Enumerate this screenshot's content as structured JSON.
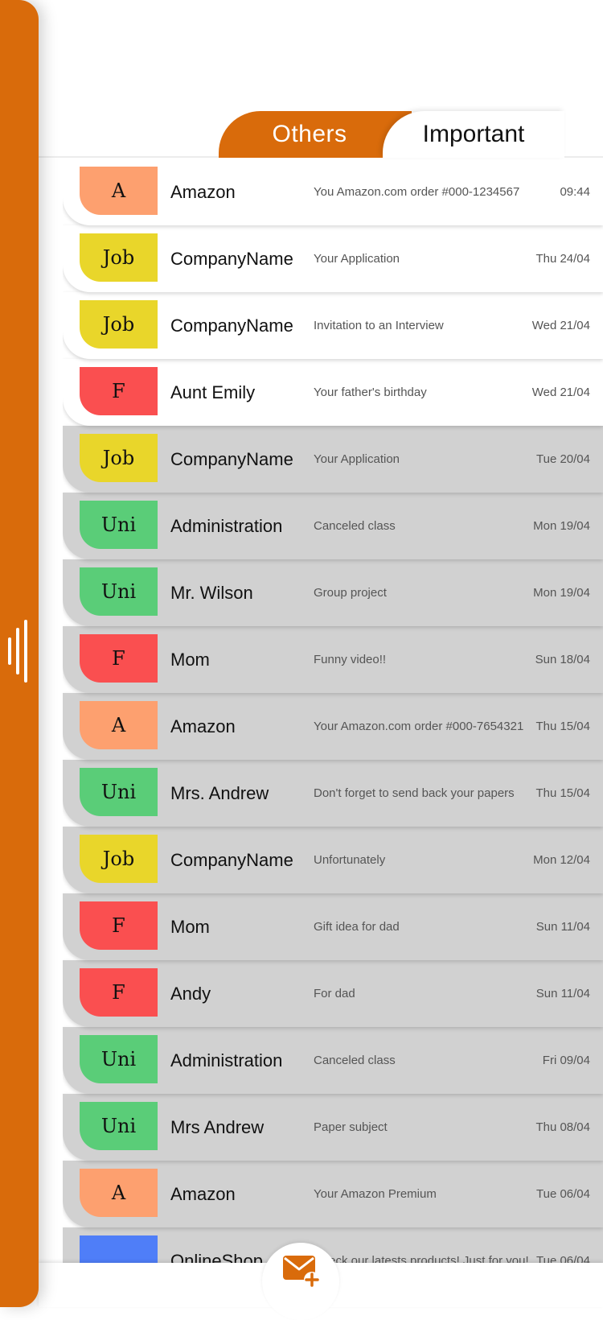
{
  "colors": {
    "accent": "#d96b0b",
    "read_row": "#d1d1d1",
    "unread_row": "#ffffff",
    "categories": {
      "A": "#fda06f",
      "Job": "#e9d62a",
      "F": "#fa4f50",
      "Uni": "#5acd78",
      "OnlineShop": "#4f7ef8"
    }
  },
  "tabs": {
    "others": "Others",
    "important": "Important"
  },
  "sidebar": {
    "handle_icon": "handle-bars-icon"
  },
  "compose": {
    "icon": "mail-plus-icon"
  },
  "emails": [
    {
      "badge": "A",
      "category": "A",
      "sender": "Amazon",
      "subject": "You Amazon.com order #000-1234567",
      "date": "09:44",
      "read": false
    },
    {
      "badge": "Job",
      "category": "Job",
      "sender": "CompanyName",
      "subject": "Your Application",
      "date": "Thu 24/04",
      "read": false
    },
    {
      "badge": "Job",
      "category": "Job",
      "sender": "CompanyName",
      "subject": "Invitation to an Interview",
      "date": "Wed 21/04",
      "read": false
    },
    {
      "badge": "F",
      "category": "F",
      "sender": "Aunt Emily",
      "subject": "Your father's birthday",
      "date": "Wed 21/04",
      "read": false
    },
    {
      "badge": "Job",
      "category": "Job",
      "sender": "CompanyName",
      "subject": "Your Application",
      "date": "Tue 20/04",
      "read": true
    },
    {
      "badge": "Uni",
      "category": "Uni",
      "sender": "Administration",
      "subject": "Canceled class",
      "date": "Mon 19/04",
      "read": true
    },
    {
      "badge": "Uni",
      "category": "Uni",
      "sender": "Mr. Wilson",
      "subject": "Group project",
      "date": "Mon 19/04",
      "read": true
    },
    {
      "badge": "F",
      "category": "F",
      "sender": "Mom",
      "subject": "Funny video!!",
      "date": "Sun 18/04",
      "read": true
    },
    {
      "badge": "A",
      "category": "A",
      "sender": "Amazon",
      "subject": "Your Amazon.com order #000-7654321",
      "date": "Thu 15/04",
      "read": true
    },
    {
      "badge": "Uni",
      "category": "Uni",
      "sender": "Mrs. Andrew",
      "subject": "Don't forget to send back your papers",
      "date": "Thu 15/04",
      "read": true
    },
    {
      "badge": "Job",
      "category": "Job",
      "sender": "CompanyName",
      "subject": "Unfortunately",
      "date": "Mon 12/04",
      "read": true
    },
    {
      "badge": "F",
      "category": "F",
      "sender": "Mom",
      "subject": "Gift idea for dad",
      "date": "Sun 11/04",
      "read": true
    },
    {
      "badge": "F",
      "category": "F",
      "sender": "Andy",
      "subject": "For dad",
      "date": "Sun 11/04",
      "read": true
    },
    {
      "badge": "Uni",
      "category": "Uni",
      "sender": "Administration",
      "subject": "Canceled class",
      "date": "Fri 09/04",
      "read": true
    },
    {
      "badge": "Uni",
      "category": "Uni",
      "sender": "Mrs Andrew",
      "subject": "Paper subject",
      "date": "Thu 08/04",
      "read": true
    },
    {
      "badge": "A",
      "category": "A",
      "sender": "Amazon",
      "subject": "Your Amazon Premium",
      "date": "Tue 06/04",
      "read": true
    },
    {
      "badge": "",
      "category": "OnlineShop",
      "sender": "OnlineShop",
      "subject": "Check our latests products! Just for you!",
      "date": "Tue 06/04",
      "read": true
    }
  ]
}
